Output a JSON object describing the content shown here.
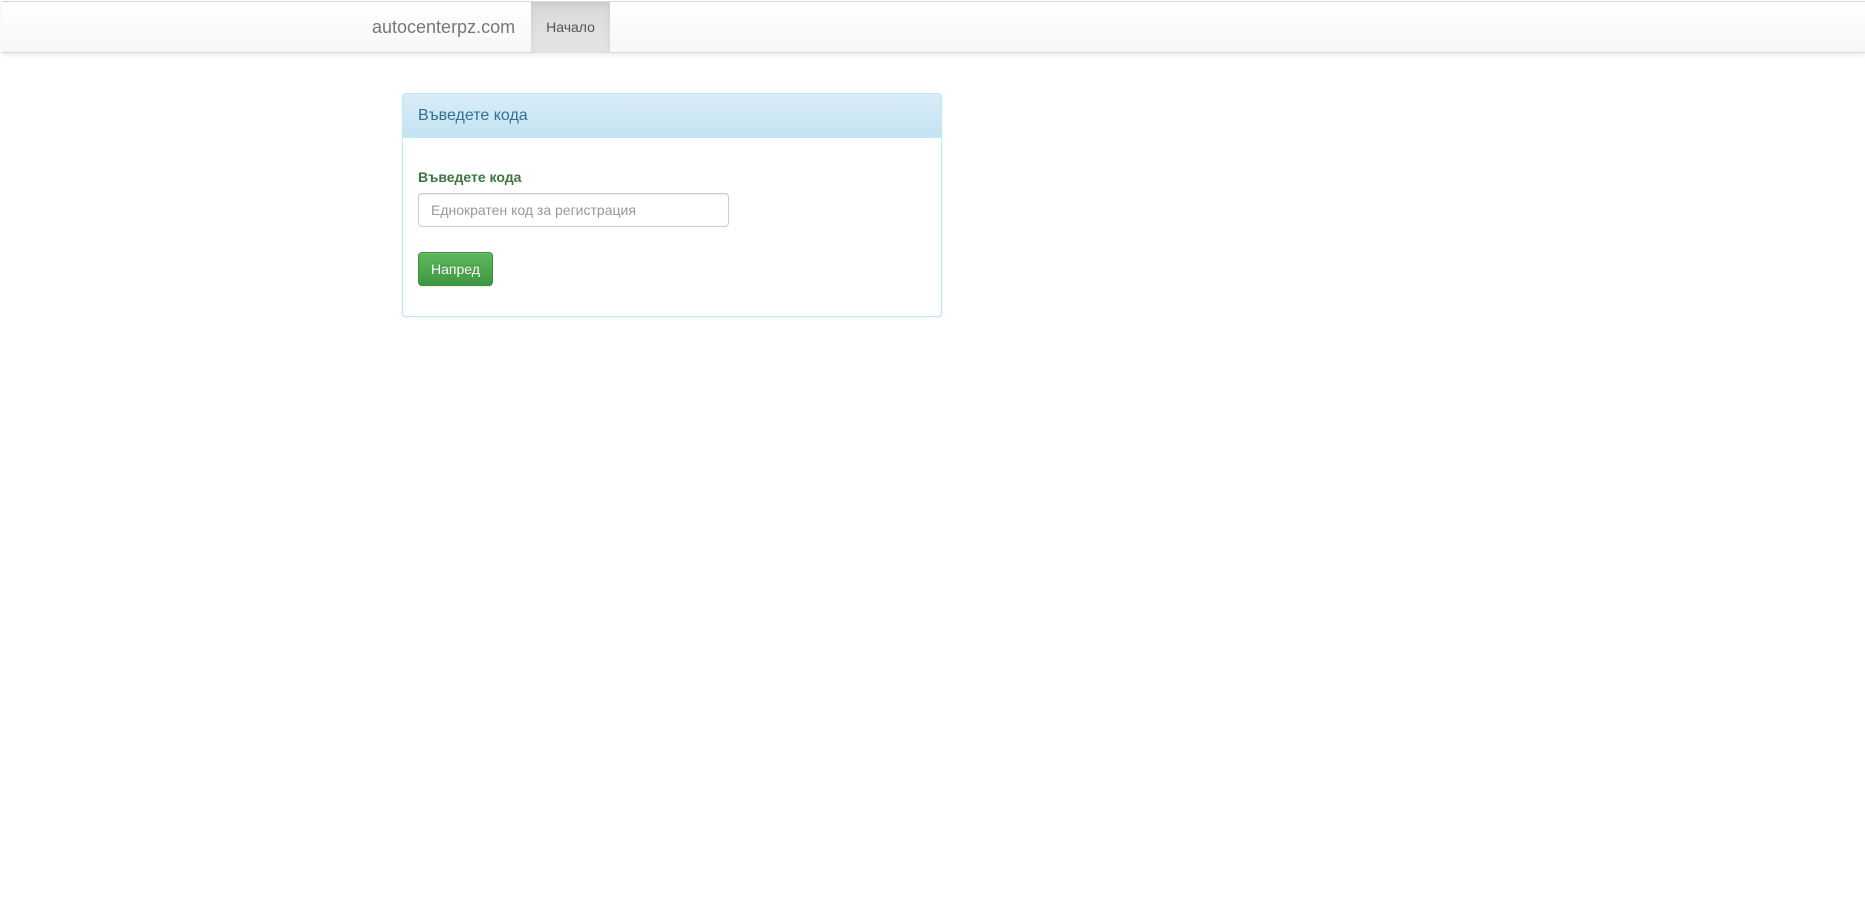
{
  "navbar": {
    "brand": "autocenterpz.com",
    "tabs": [
      {
        "label": "Начало",
        "active": true
      }
    ]
  },
  "panel": {
    "title": "Въведете кода",
    "form": {
      "label": "Въведете кода",
      "input_value": "",
      "input_placeholder": "Еднократен код за регистрация",
      "submit_label": "Напред"
    }
  },
  "colors": {
    "panel_heading_text": "#31708f",
    "panel_border": "#bce8f1",
    "label_success": "#3c763d",
    "button_success": "#5cb85c"
  }
}
